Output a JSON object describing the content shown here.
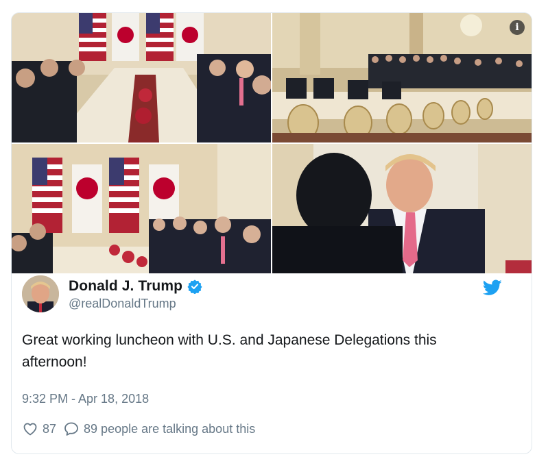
{
  "tweet": {
    "display_name": "Donald J. Trump",
    "handle": "@realDonaldTrump",
    "verified": true,
    "text": "Great working luncheon with U.S. and Japanese Delegations this afternoon!",
    "timestamp": "9:32 PM - Apr 18, 2018",
    "likes": "87",
    "conversation": "89 people are talking about this"
  },
  "media": {
    "info_icon": "i",
    "photos": [
      {
        "name": "photo-luncheon-table-flags",
        "subject": "delegations seated at long table with US and Japan flags"
      },
      {
        "name": "photo-banquet-hall-press",
        "subject": "wide view of banquet hall with press photographers"
      },
      {
        "name": "photo-delegations-flags-wide",
        "subject": "delegations at table in front of alternating flags"
      },
      {
        "name": "photo-trump-across-table",
        "subject": "man in pink striped tie seen over shoulder"
      }
    ]
  },
  "icons": {
    "verified": "verified-badge-icon",
    "twitter": "twitter-bird-icon",
    "like": "heart-icon",
    "reply": "speech-bubble-icon",
    "info": "info-icon"
  },
  "colors": {
    "twitter_blue": "#1da1f2",
    "text_primary": "#14171a",
    "text_secondary": "#657786",
    "border": "#e1e8ed"
  }
}
